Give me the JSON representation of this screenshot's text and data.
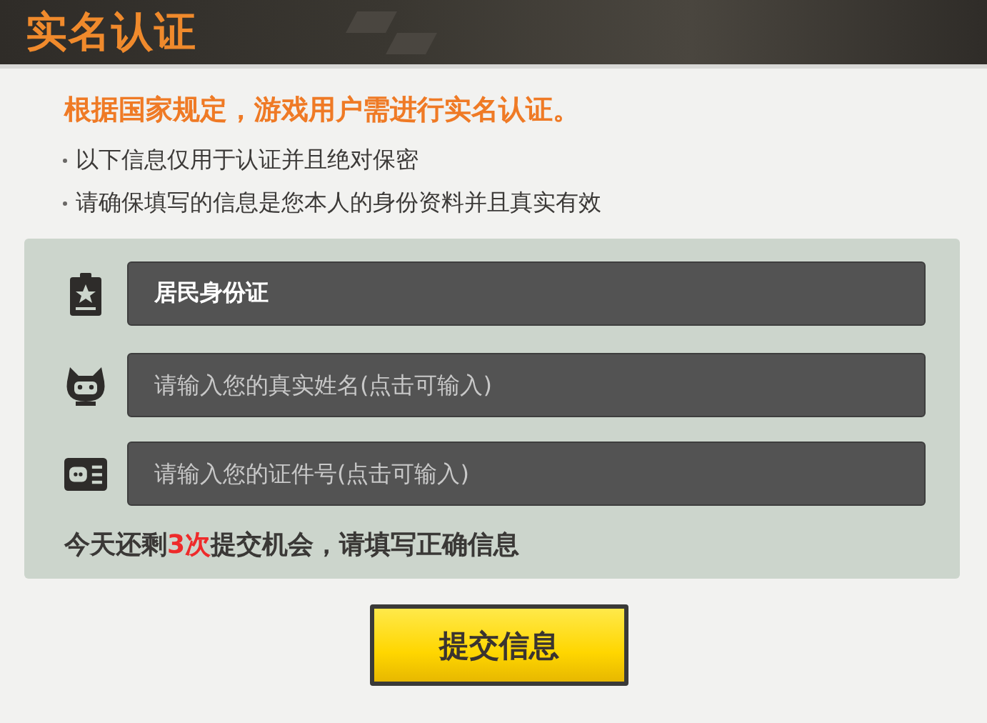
{
  "window": {
    "title": "实名认证"
  },
  "notice": "根据国家规定，游戏用户需进行实名认证。",
  "bullets": [
    "以下信息仅用于认证并且绝对保密",
    "请确保填写的信息是您本人的身份资料并且真实有效"
  ],
  "fields": [
    {
      "kind": "id-type",
      "value": "居民身份证"
    },
    {
      "kind": "name",
      "placeholder": "请输入您的真实姓名(点击可输入)"
    },
    {
      "kind": "id-number",
      "placeholder": "请输入您的证件号(点击可输入)"
    }
  ],
  "attempts": {
    "before": "今天还剩",
    "count": "3次",
    "after": "提交机会，请填写正确信息"
  },
  "submit_button": "提交信息"
}
